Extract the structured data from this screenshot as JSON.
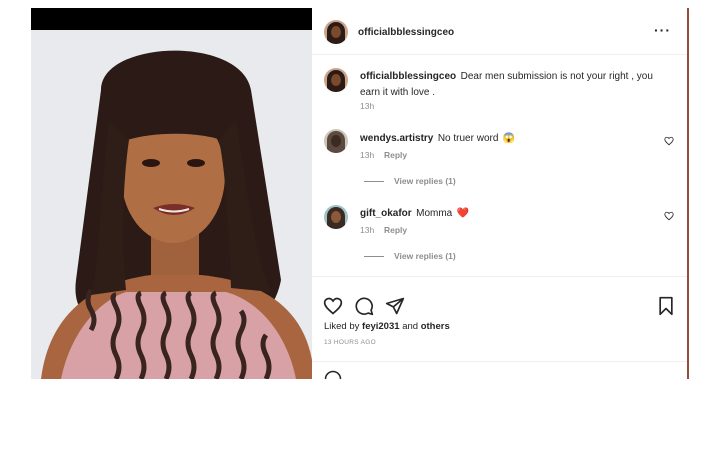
{
  "post": {
    "username": "officialbblessingceo",
    "caption": "Dear men submission is not your right , you earn it with love .",
    "caption_time": "13h",
    "more_icon": "more-horizontal-icon"
  },
  "comments": [
    {
      "username": "wendys.artistry",
      "text": "No truer word",
      "emoji": "😱",
      "time": "13h",
      "reply": "Reply",
      "view_replies": "View replies (1)"
    },
    {
      "username": "gift_okafor",
      "text": "Momma",
      "emoji": "❤️",
      "time": "13h",
      "reply": "Reply",
      "view_replies": "View replies (1)"
    }
  ],
  "actions": {
    "icons": [
      "heart-icon",
      "comment-icon",
      "share-icon",
      "bookmark-icon"
    ],
    "liked_prefix": "Liked by",
    "liked_user": "feyi2031",
    "liked_and": "and",
    "liked_others": "others",
    "timestamp": "13 HOURS AGO"
  },
  "colors": {
    "heart_red": "#e0245e",
    "muted": "#8e8e8e",
    "dress_pink": "#d9a3a8"
  }
}
